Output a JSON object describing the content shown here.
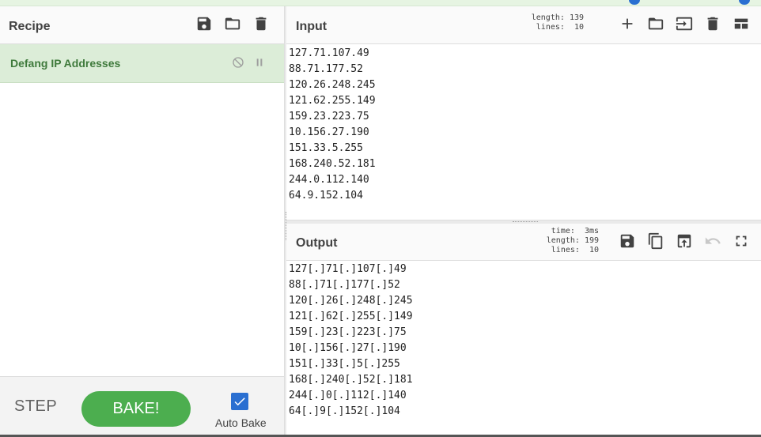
{
  "recipe": {
    "title": "Recipe",
    "operation": "Defang IP Addresses",
    "icons": [
      "save-icon",
      "folder-icon",
      "trash-icon",
      "disable-icon",
      "pause-icon"
    ]
  },
  "controls": {
    "step_label": "STEP",
    "bake_label": "BAKE!",
    "autobake_label": "Auto Bake",
    "autobake_checked": true
  },
  "input": {
    "title": "Input",
    "length_label": "length:",
    "length_value": "139",
    "lines_label": "lines:",
    "lines_value": "10",
    "lines": [
      "127.71.107.49",
      "88.71.177.52",
      "120.26.248.245",
      "121.62.255.149",
      "159.23.223.75",
      "10.156.27.190",
      "151.33.5.255",
      "168.240.52.181",
      "244.0.112.140",
      "64.9.152.104"
    ]
  },
  "output": {
    "title": "Output",
    "time_label": "time:",
    "time_value": "3ms",
    "length_label": "length:",
    "length_value": "199",
    "lines_label": "lines:",
    "lines_value": "10",
    "lines": [
      "127[.]71[.]107[.]49",
      "88[.]71[.]177[.]52",
      "120[.]26[.]248[.]245",
      "121[.]62[.]255[.]149",
      "159[.]23[.]223[.]75",
      "10[.]156[.]27[.]190",
      "151[.]33[.]5[.]255",
      "168[.]240[.]52[.]181",
      "244[.]0[.]112[.]140",
      "64[.]9[.]152[.]104"
    ]
  },
  "colors": {
    "accent_green": "#4cae4f",
    "operation_bg": "#dcedd8",
    "operation_text": "#3f7a3c",
    "checkbox_blue": "#2a6fd1"
  }
}
